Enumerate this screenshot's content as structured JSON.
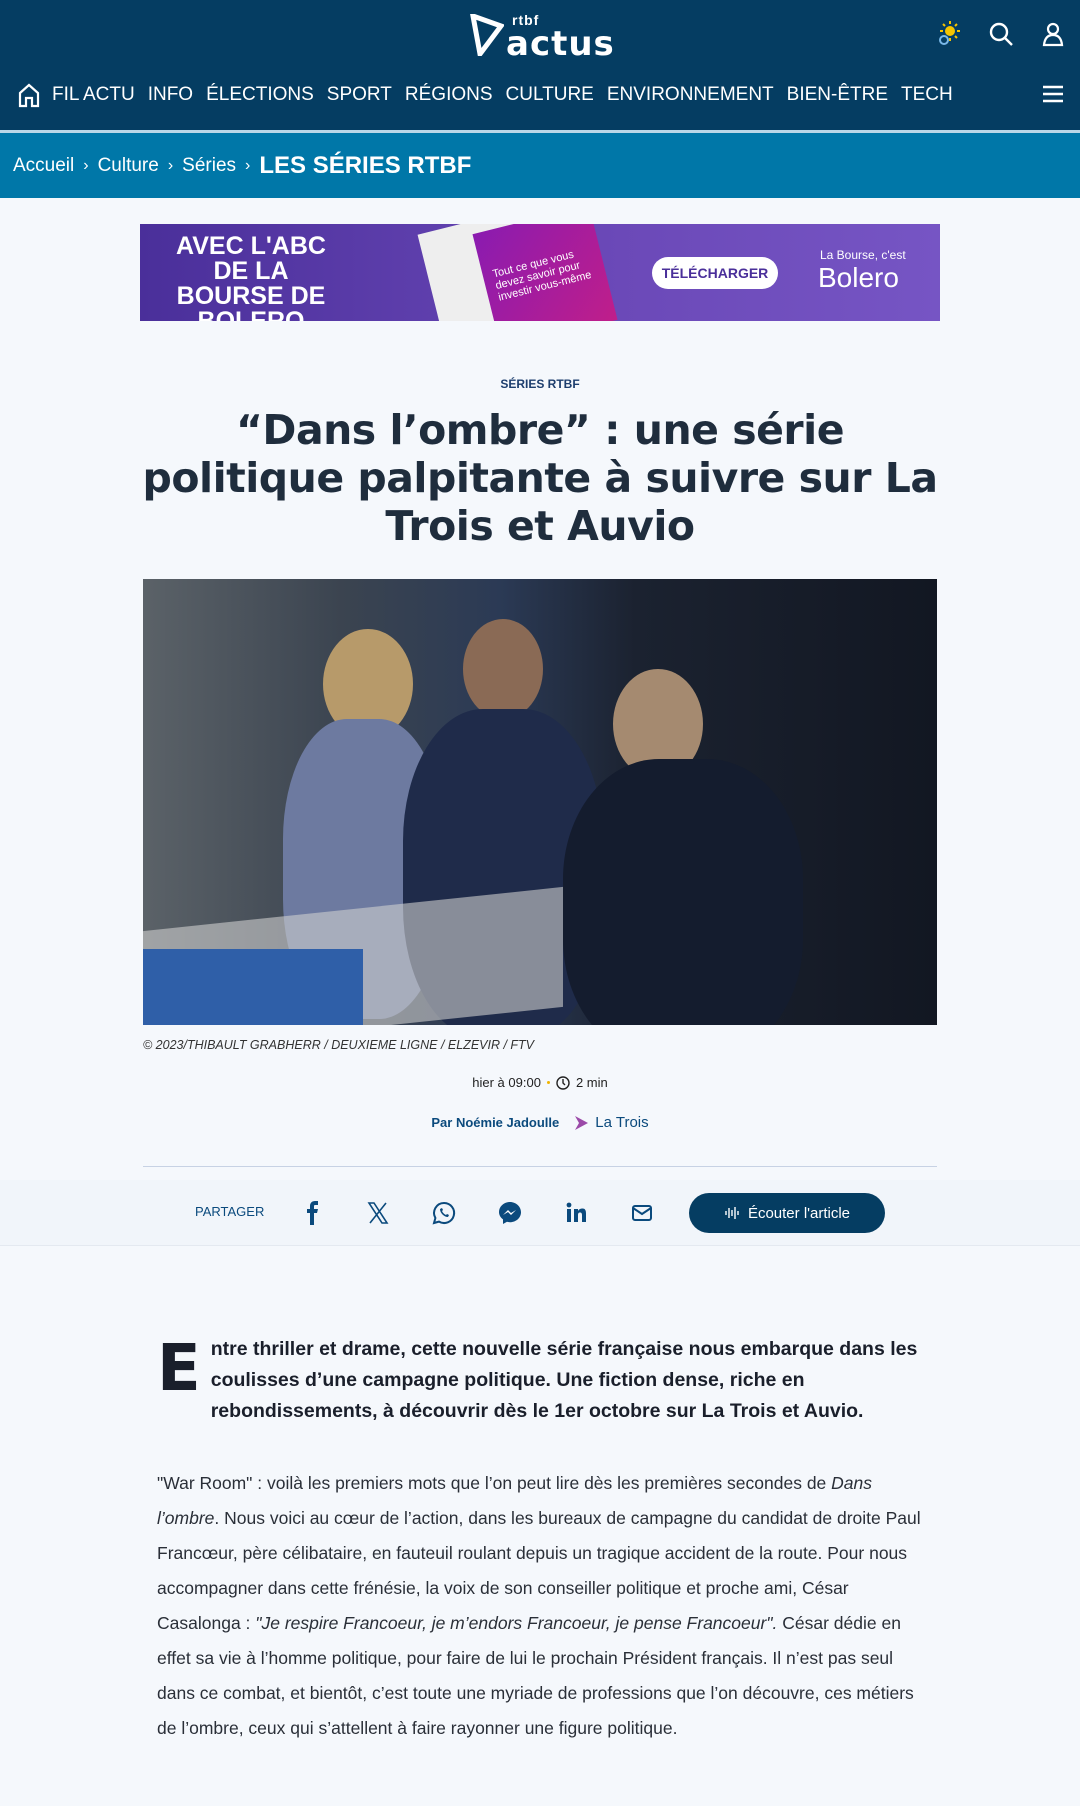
{
  "header": {
    "logo_small": "rtbf",
    "logo_big": "actus",
    "nav": [
      "FIL ACTU",
      "INFO",
      "ÉLECTIONS",
      "SPORT",
      "RÉGIONS",
      "CULTURE",
      "ENVIRONNEMENT",
      "BIEN-ÊTRE",
      "TECH"
    ]
  },
  "breadcrumb": {
    "items": [
      "Accueil",
      "Culture",
      "Séries"
    ],
    "current": "LES SÉRIES RTBF"
  },
  "ad": {
    "headline": "AVEC L'ABC DE LA BOURSE DE BOLERO",
    "card_text": "Tout ce que vous devez savoir pour investir vous-même",
    "cta": "TÉLÉCHARGER",
    "tagline": "La Bourse, c'est",
    "brand": "Bolero"
  },
  "article": {
    "kicker": "SÉRIES RTBF",
    "title": "“Dans l’ombre” : une série politique palpitante à suivre sur La Trois et Auvio",
    "caption": "© 2023/THIBAULT GRABHERR / DEUXIEME LIGNE / ELZEVIR / FTV",
    "date": "hier à 09:00",
    "read_time": "2 min",
    "author": "Par Noémie Jadoulle",
    "channel": "La Trois",
    "lead_cap": "E",
    "lead": "ntre thriller et drame, cette nouvelle série française nous embarque dans les coulisses d’une campagne politique. Une fiction dense, riche en rebondissements, à découvrir dès le 1er octobre sur La Trois et Auvio.",
    "p1a": "\"War Room\" : voilà les premiers mots que l’on peut lire dès les premières secondes de ",
    "p1b": "Dans l’ombre",
    "p1c": ". Nous voici au cœur de l’action, dans les bureaux de campagne du candidat de droite Paul Francœur, père célibataire, en fauteuil roulant depuis un tragique accident de la route. Pour nous accompagner dans cette frénésie, la voix de son conseiller politique et proche ami, César Casalonga : ",
    "p1d": "\"Je respire Francoeur, je m’endors Francoeur, je pense Francoeur\".",
    "p1e": " César dédie en effet sa vie à l’homme politique, pour faire de lui le prochain Président français. Il n’est pas seul dans ce combat, et bientôt, c’est toute une myriade de professions que l’on découvre, ces métiers de l’ombre, ceux qui s’attellent à faire rayonner une figure politique."
  },
  "share": {
    "label": "PARTAGER",
    "listen": "Écouter l'article"
  },
  "colors": {
    "header": "#053d62",
    "breadcrumb": "#0077a8",
    "accent": "#0b4a7d"
  }
}
